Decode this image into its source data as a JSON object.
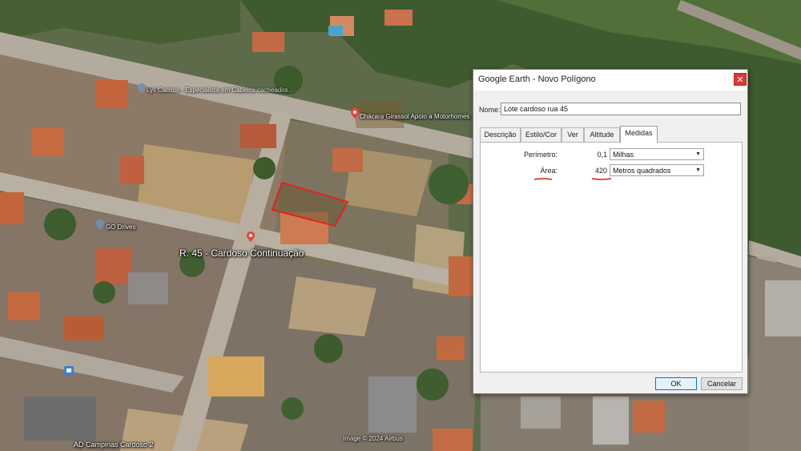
{
  "map": {
    "labels": {
      "street": "R. 45 - Cardoso Continuação",
      "chacara": "Chácara Girassol Apoio a Motorhomes",
      "go_drives": "GO Drives",
      "top_business": "Lyli Cachos - Especialista em Cabelos cacheados...",
      "bottom_left": "AD Campinas Cardoso 2",
      "copyright": "Image © 2024 Airbus"
    },
    "colors": {
      "polygon_outline": "#e0231e",
      "pin": "#e8433a"
    }
  },
  "dialog": {
    "title": "Google Earth - Novo Polígono",
    "close_icon": "close-icon",
    "name_label": "Nome:",
    "name_value": "Lote cardoso rua 45",
    "tabs": [
      "Descrição",
      "Estilo/Cor",
      "Ver",
      "Altitude",
      "Medidas"
    ],
    "active_tab": "Medidas",
    "perimeter": {
      "label": "Perímetro:",
      "value": "0,1",
      "unit": "Milhas"
    },
    "area": {
      "label": "Área:",
      "value": "420",
      "unit": "Metros quadrados"
    },
    "annotation_color": "#d91a1a",
    "ok_label": "OK",
    "cancel_label": "Cancelar"
  }
}
